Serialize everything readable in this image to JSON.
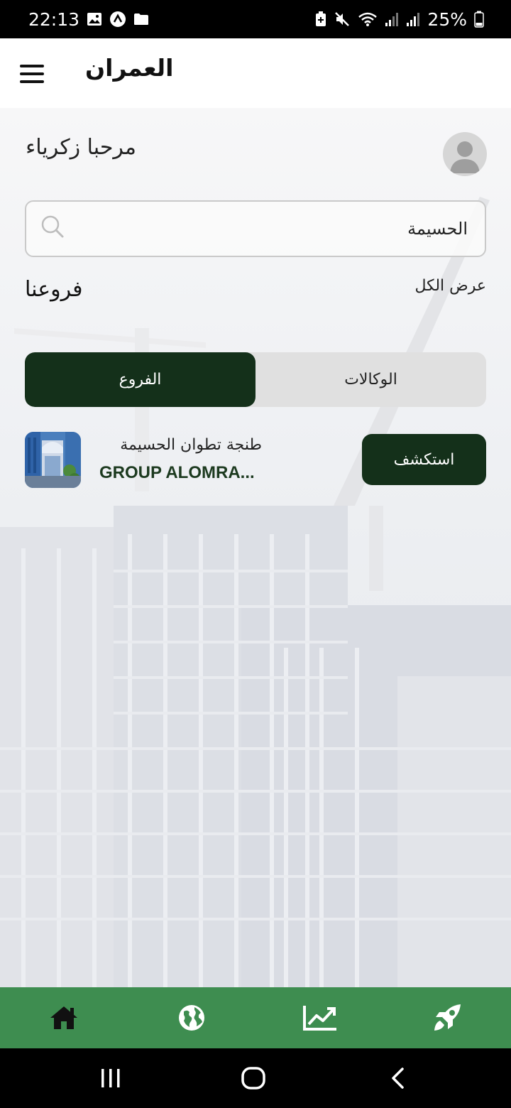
{
  "status_bar": {
    "time": "22:13",
    "battery": "25%"
  },
  "header": {
    "title": "العمران"
  },
  "greeting": "مرحبا زكرياء",
  "search": {
    "value": "الحسيمة"
  },
  "section": {
    "title": "فروعنا",
    "view_all": "عرض الكل"
  },
  "tabs": [
    {
      "label": "الفروع",
      "active": true
    },
    {
      "label": "الوكالات",
      "active": false
    }
  ],
  "branch": {
    "cities": "طنجة تطوان الحسيمة",
    "name": "GROUP ALOMRA...",
    "button": "استكشف"
  },
  "bottom_nav": [
    "home-icon",
    "globe-icon",
    "chart-icon",
    "rocket-icon"
  ],
  "colors": {
    "primary_dark": "#14301a",
    "nav_green": "#3e8d50",
    "branch_name": "#1c3a1f"
  }
}
